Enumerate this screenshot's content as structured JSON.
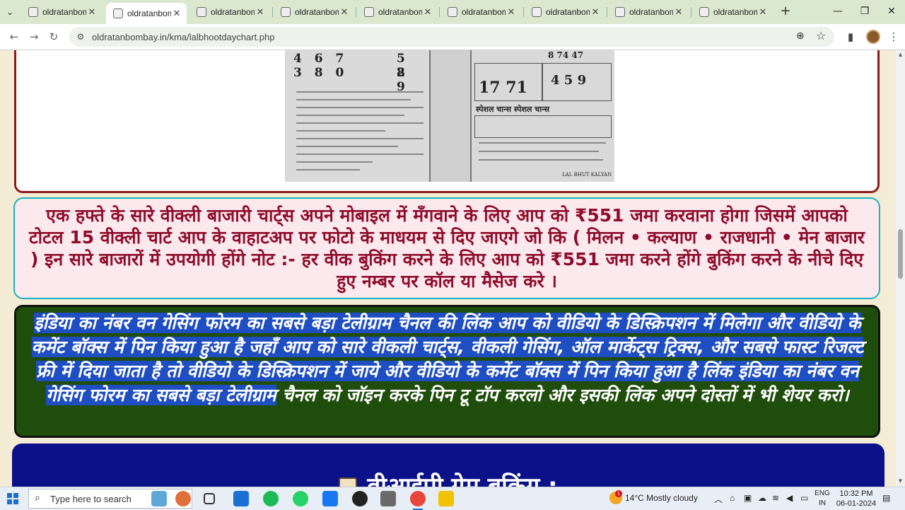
{
  "browser": {
    "tabs": [
      {
        "title": "oldratanbomba",
        "active": false
      },
      {
        "title": "oldratanbomba",
        "active": true
      },
      {
        "title": "oldratanbomba",
        "active": false
      },
      {
        "title": "oldratanbomba",
        "active": false
      },
      {
        "title": "oldratanbomba",
        "active": false
      },
      {
        "title": "oldratanbomba",
        "active": false
      },
      {
        "title": "oldratanbomba",
        "active": false
      },
      {
        "title": "oldratanbomba",
        "active": false
      },
      {
        "title": "oldratanbomba",
        "active": false
      }
    ],
    "url": "oldratanbombay.in/kma/lalbhootdaychart.php"
  },
  "newspaper": {
    "row1": "4 6 7",
    "row2": "3 8 0",
    "row1_right": "5 8",
    "row2_right": "2 9",
    "top_right_nums": "8 74 47",
    "big_nums": "17 71",
    "kalyan_nums": "4 5 9",
    "special_heading": "स्पेशल चान्स  स्पेशल चान्स",
    "footer": "LAL BHUT KALYAN"
  },
  "notice": {
    "text": "एक हफ्ते के सारे वीक्ली बाजारी चार्ट्स अपने मोबाइल में मँगवाने के लिए आप को ₹551 जमा करवाना होगा जिसमें आपको टोटल 15 वीक्ली चार्ट आप के वाहाटअप पर फोटो के माधयम से दिए जाएगे जो कि ( मिलन • कल्याण • राजधानी • मेन बाजार ) इन सारे बाजारों में उपयोगी होंगे नोट :- हर वीक बुकिंग करने के लिए आप को ₹551 जमा करने होंगे बुकिंग करने के नीचे दिए हुए नम्बर पर कॉल या मैसेज करे ।"
  },
  "promo": {
    "selected_text": "इंडिया का नंबर वन गेसिंग फोरम का सबसे बड़ा टेलीग्राम चैनल की लिंक आप को वीडियो के डिस्क्रिपशन में मिलेगा और वीडियो के कमेंट बॉक्स में पिन किया हुआ है जहाँ आप को सारे वीकली चार्ट्स, वीकली गेसिंग, ऑल मार्केट्स ट्रिक्स, और सबसे फास्ट रिजल्ट फ्री में दिया जाता है तो वीडियो के डिस्क्रिपशन में जाये और वीडियो के कमेंट बॉक्स में पिन किया हुआ है लिंक इंडिया का नंबर वन गेसिंग फोरम का सबसे बड़ा टेलीग्राम",
    "rest_text": " चैनल को जॉइन करके पिन टू टॉप करलो और इसकी लिंक अपने दोस्तों में भी शेयर करो।"
  },
  "booking": {
    "title": "वीआईपी गेम बुकिंग :"
  },
  "taskbar": {
    "search_placeholder": "Type here to search",
    "weather": "14°C  Mostly cloudy",
    "weather_badge": "1",
    "lang_line1": "ENG",
    "lang_line2": "IN",
    "time": "10:32 PM",
    "date": "06-01-2024"
  },
  "colors": {
    "notice_text": "#8f0d2c",
    "notice_border": "#1ab3bf",
    "promo_bg": "#1f4d0c",
    "booking_bg": "#0b1189",
    "card_border": "#8b1a1a"
  }
}
